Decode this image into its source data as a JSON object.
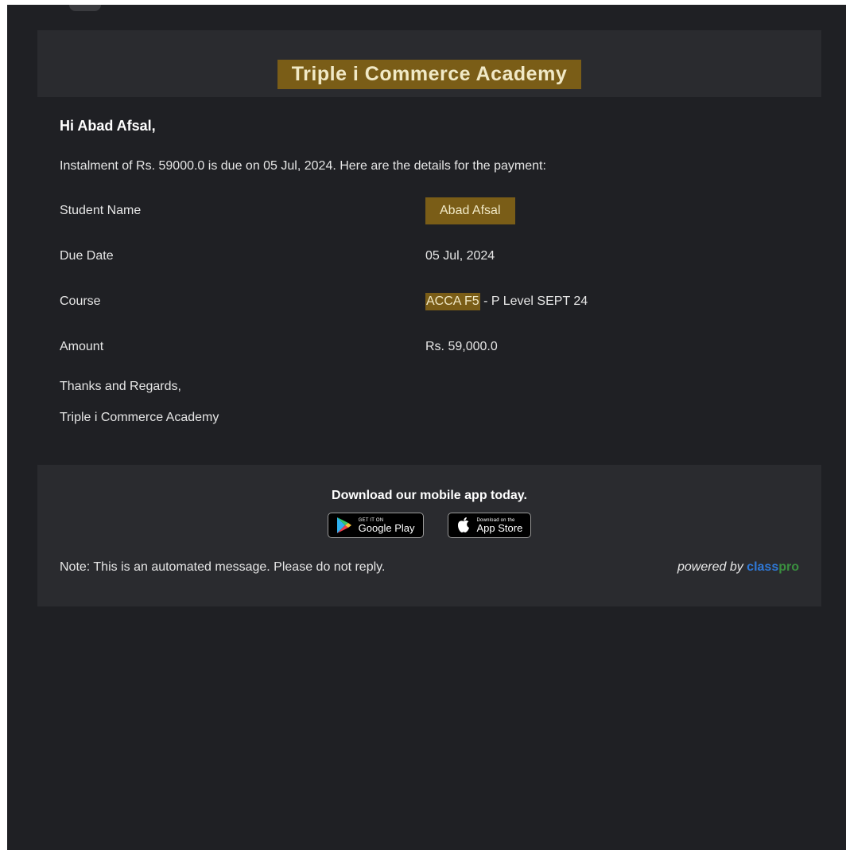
{
  "email": {
    "brand": "Triple i Commerce Academy",
    "greeting": "Hi Abad Afsal,",
    "intro": "Instalment of Rs. 59000.0 is due on 05 Jul, 2024. Here are the details for the payment:",
    "details": [
      {
        "label": "Student Name",
        "value": "Abad Afsal"
      },
      {
        "label": "Due Date",
        "value": "05 Jul, 2024"
      },
      {
        "label": "Course",
        "value_highlight": "ACCA F5",
        "value_rest": " - P Level SEPT 24"
      },
      {
        "label": "Amount",
        "value": "Rs. 59,000.0"
      }
    ],
    "closing": "Thanks and Regards,",
    "signature": "Triple i Commerce Academy"
  },
  "footer": {
    "download_text": "Download our mobile app today.",
    "google_play": {
      "small": "GET IT ON",
      "big": "Google Play"
    },
    "app_store": {
      "small": "Download on the",
      "big": "App Store"
    },
    "note": "Note: This is an automated message. Please do not reply.",
    "powered_by": "powered by",
    "brand_class": "class",
    "brand_pro": "pro"
  },
  "colors": {
    "background": "#1f2024",
    "panel": "#2a2b2f",
    "highlight": "#7a5d17",
    "classpro_blue": "#2f78d6",
    "classpro_green": "#3a8f3f"
  }
}
